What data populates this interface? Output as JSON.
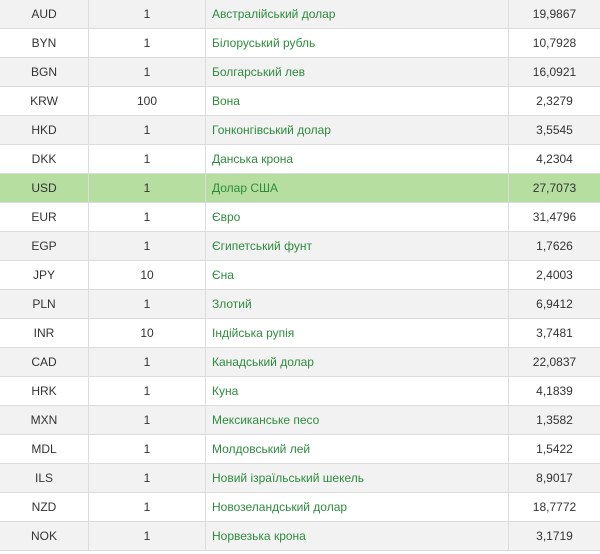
{
  "rows": [
    {
      "code": "AUD",
      "units": "1",
      "name": "Австралійський долар",
      "rate": "19,9867"
    },
    {
      "code": "BYN",
      "units": "1",
      "name": "Білоруський рубль",
      "rate": "10,7928"
    },
    {
      "code": "BGN",
      "units": "1",
      "name": "Болгарський лев",
      "rate": "16,0921"
    },
    {
      "code": "KRW",
      "units": "100",
      "name": "Вона",
      "rate": "2,3279"
    },
    {
      "code": "HKD",
      "units": "1",
      "name": "Гонконгівський долар",
      "rate": "3,5545"
    },
    {
      "code": "DKK",
      "units": "1",
      "name": "Данська крона",
      "rate": "4,2304"
    },
    {
      "code": "USD",
      "units": "1",
      "name": "Долар США",
      "rate": "27,7073",
      "highlighted": true
    },
    {
      "code": "EUR",
      "units": "1",
      "name": "Євро",
      "rate": "31,4796"
    },
    {
      "code": "EGP",
      "units": "1",
      "name": "Єгипетський фунт",
      "rate": "1,7626"
    },
    {
      "code": "JPY",
      "units": "10",
      "name": "Єна",
      "rate": "2,4003"
    },
    {
      "code": "PLN",
      "units": "1",
      "name": "Злотий",
      "rate": "6,9412"
    },
    {
      "code": "INR",
      "units": "10",
      "name": "Індійська рупія",
      "rate": "3,7481"
    },
    {
      "code": "CAD",
      "units": "1",
      "name": "Канадський долар",
      "rate": "22,0837"
    },
    {
      "code": "HRK",
      "units": "1",
      "name": "Куна",
      "rate": "4,1839"
    },
    {
      "code": "MXN",
      "units": "1",
      "name": "Мексиканське песо",
      "rate": "1,3582"
    },
    {
      "code": "MDL",
      "units": "1",
      "name": "Молдовський лей",
      "rate": "1,5422"
    },
    {
      "code": "ILS",
      "units": "1",
      "name": "Новий ізраїльський шекель",
      "rate": "8,9017"
    },
    {
      "code": "NZD",
      "units": "1",
      "name": "Новозеландський долар",
      "rate": "18,7772"
    },
    {
      "code": "NOK",
      "units": "1",
      "name": "Норвезька крона",
      "rate": "3,1719"
    }
  ],
  "colors": {
    "link_green": "#2e8b3e",
    "highlight_row": "#b5dea0",
    "odd_row": "#f2f2f2",
    "even_row": "#ffffff",
    "border": "#dcdcdc",
    "text": "#333333"
  }
}
